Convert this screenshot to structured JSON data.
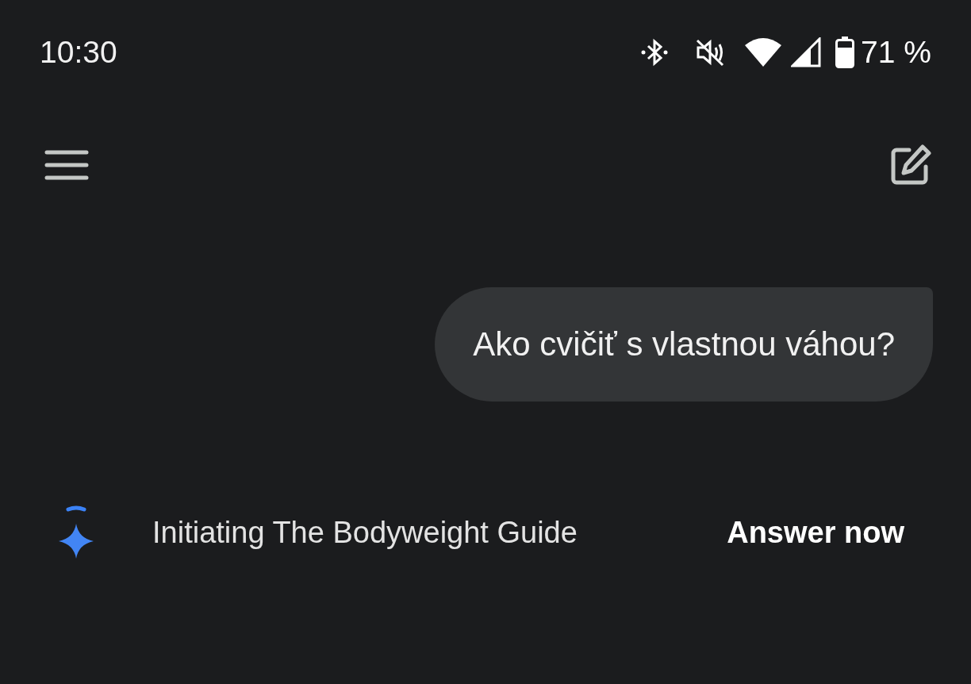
{
  "status_bar": {
    "time": "10:30",
    "battery": "71 %"
  },
  "messages": [
    {
      "kind": "user",
      "text": "Ako cvičiť s vlastnou váhou?"
    }
  ],
  "progress": {
    "text": "Initiating The Bodyweight Guide",
    "action": "Answer now"
  }
}
